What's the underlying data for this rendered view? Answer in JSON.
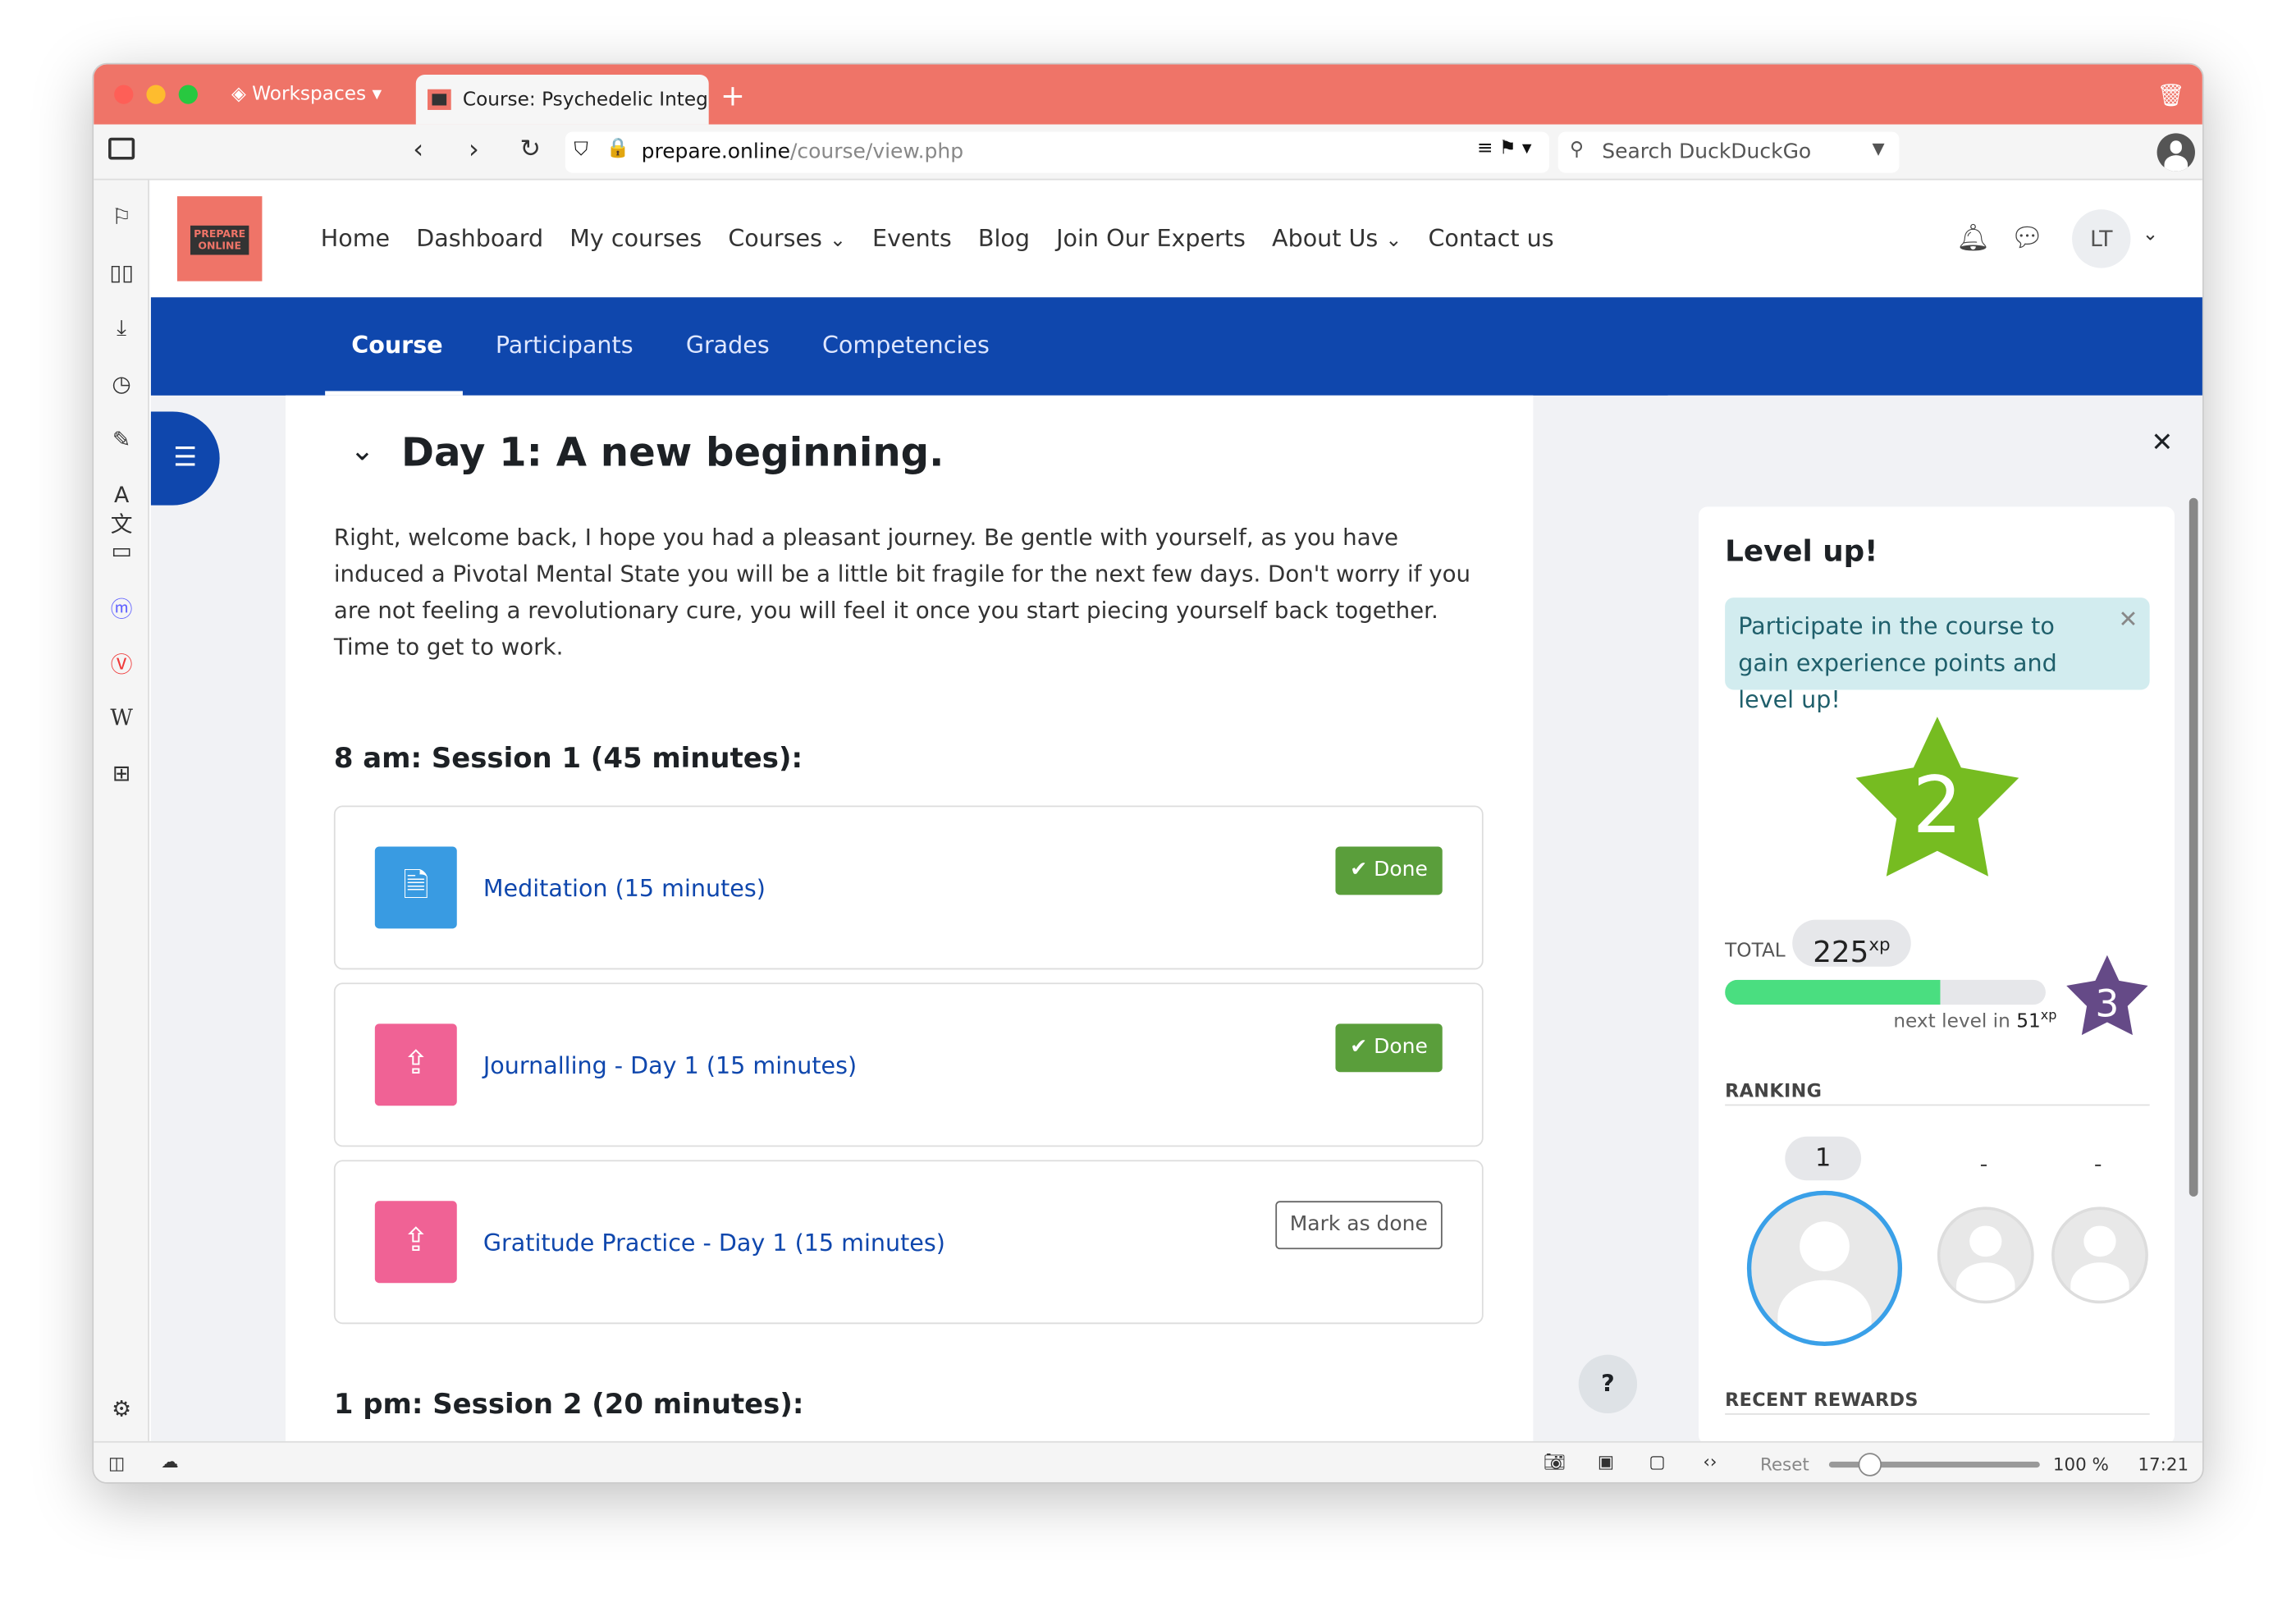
{
  "browser": {
    "workspaces_label": "Workspaces",
    "tab_title": "Course: Psychedelic Integr",
    "url_host": "prepare.online",
    "url_path": "/course/view.php",
    "search_placeholder": "Search DuckDuckGo",
    "status": {
      "reset_label": "Reset",
      "zoom": "100 %",
      "zoom_level": 100,
      "time": "17:21"
    }
  },
  "site": {
    "logo_text": "PREPARE ONLINE",
    "nav": [
      "Home",
      "Dashboard",
      "My courses",
      "Courses",
      "Events",
      "Blog",
      "Join Our Experts",
      "About Us",
      "Contact us"
    ],
    "user_initials": "LT",
    "course_tabs": [
      "Course",
      "Participants",
      "Grades",
      "Competencies"
    ]
  },
  "content": {
    "section_title": "Day 1: A new beginning.",
    "intro": "Right, welcome back, I hope you had a pleasant journey. Be gentle with yourself, as you have induced a Pivotal Mental State you will be a little bit fragile for the next few days. Don't worry if you are not feeling a revolutionary cure, you will feel it once you start piecing yourself back together. Time to get to work.",
    "session1": "8 am: Session 1 (45 minutes):",
    "activities": [
      {
        "title": "Meditation (15 minutes)",
        "status": "Done",
        "icon": "page-icon",
        "color": "#399be2"
      },
      {
        "title": "Journalling - Day 1 (15 minutes)",
        "status": "Done",
        "icon": "assignment-icon",
        "color": "#f06295"
      },
      {
        "title": "Gratitude Practice - Day 1 (15 minutes)",
        "status": "Mark as done",
        "icon": "assignment-icon",
        "color": "#f06295"
      }
    ],
    "session2": "1 pm: Session 2 (20 minutes):"
  },
  "levelup": {
    "title": "Level up!",
    "alert": "Participate in the course to gain experience points and level up!",
    "level": "2",
    "total_label": "TOTAL",
    "total_xp": "225",
    "xp_suffix": "xp",
    "progress_percent": 67,
    "next_level_text": "next level in",
    "next_level_xp": "51",
    "next_level": "3",
    "ranking_label": "RANKING",
    "ranks": [
      "1",
      "-",
      "-"
    ],
    "recent_rewards_label": "RECENT REWARDS",
    "colors": {
      "level_star": "#76bc21",
      "next_star": "#654a87",
      "progress": "#4ade80"
    }
  },
  "help_label": "?"
}
